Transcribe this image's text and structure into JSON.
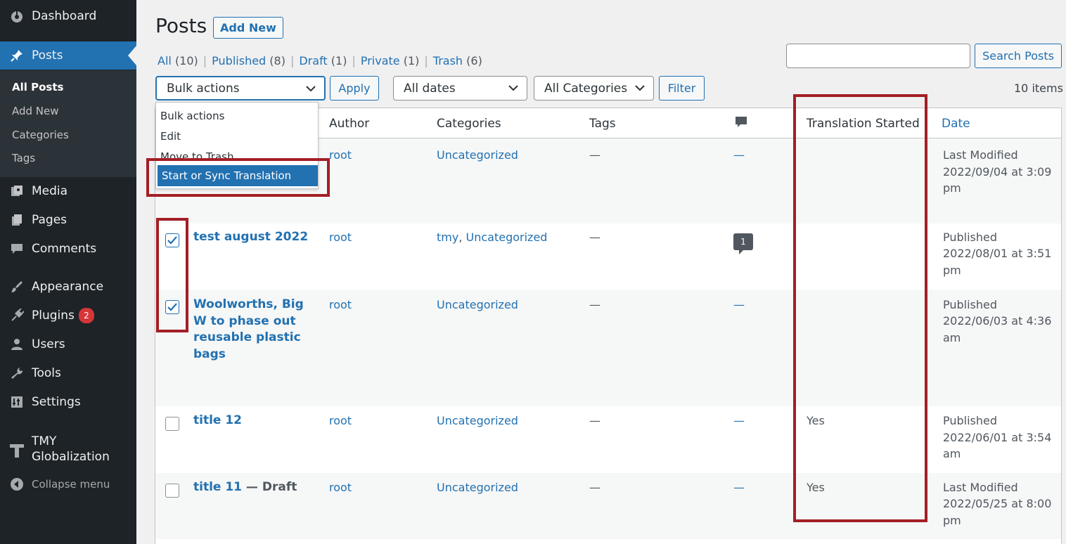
{
  "sidebar": {
    "dashboard": "Dashboard",
    "posts": "Posts",
    "sub": {
      "all_posts": "All Posts",
      "add_new": "Add New",
      "categories": "Categories",
      "tags": "Tags"
    },
    "media": "Media",
    "pages": "Pages",
    "comments": "Comments",
    "appearance": "Appearance",
    "plugins": "Plugins",
    "plugins_badge": "2",
    "users": "Users",
    "tools": "Tools",
    "settings": "Settings",
    "tmy_line1": "TMY",
    "tmy_line2": "Globalization",
    "collapse": "Collapse menu"
  },
  "header": {
    "title": "Posts",
    "add_new": "Add New"
  },
  "filters": {
    "all": "All",
    "all_count": "(10)",
    "published": "Published",
    "published_count": "(8)",
    "draft": "Draft",
    "draft_count": "(1)",
    "private": "Private",
    "private_count": "(1)",
    "trash": "Trash",
    "trash_count": "(6)",
    "sep": "|"
  },
  "search": {
    "value": "",
    "button": "Search Posts"
  },
  "tablenav": {
    "bulk_actions": "Bulk actions",
    "apply": "Apply",
    "dates": "All dates",
    "categories": "All Categories",
    "filter": "Filter",
    "items": "10 items"
  },
  "bulk_menu": {
    "options": [
      "Bulk actions",
      "Edit",
      "Move to Trash",
      "Start or Sync Translation"
    ],
    "highlighted": "Start or Sync Translation"
  },
  "columns": {
    "author": "Author",
    "categories": "Categories",
    "tags": "Tags",
    "translation": "Translation Started",
    "date": "Date"
  },
  "rows": [
    {
      "title": "",
      "author": "root",
      "cat_links": [
        "Uncategorized"
      ],
      "tags": "—",
      "comments": "—",
      "translation": "",
      "date_status": "Last Modified",
      "date_line1": "2022/09/04 at 3:09",
      "date_line2": "pm",
      "checked": false
    },
    {
      "title": "test august 2022",
      "author": "root",
      "cat_links": [
        "tmy",
        "Uncategorized"
      ],
      "cat_sep": ", ",
      "tags": "—",
      "comments": "1",
      "translation": "",
      "date_status": "Published",
      "date_line1": "2022/08/01 at 3:51",
      "date_line2": "pm",
      "checked": true
    },
    {
      "title_lines": [
        "Woolworths, Big",
        "W to phase out",
        "reusable plastic",
        "bags"
      ],
      "author": "root",
      "cat_links": [
        "Uncategorized"
      ],
      "tags": "—",
      "comments": "—",
      "translation": "",
      "date_status": "Published",
      "date_line1": "2022/06/03 at 4:36",
      "date_line2": "am",
      "checked": true
    },
    {
      "title": "title 12",
      "author": "root",
      "cat_links": [
        "Uncategorized"
      ],
      "tags": "—",
      "comments": "—",
      "translation": "Yes",
      "date_status": "Published",
      "date_line1": "2022/06/01 at 3:54",
      "date_line2": "am",
      "checked": false
    },
    {
      "title": "title 11",
      "title_state": " — Draft",
      "author": "root",
      "cat_links": [
        "Uncategorized"
      ],
      "tags": "—",
      "comments": "—",
      "translation": "Yes",
      "date_status": "Last Modified",
      "date_line1": "2022/05/25 at 8:00",
      "date_line2": "pm",
      "checked": false
    }
  ],
  "colors": {
    "sidebar": "#1d2327",
    "accent": "#2271b1",
    "annotation": "#a31f25",
    "badge": "#d63638"
  }
}
